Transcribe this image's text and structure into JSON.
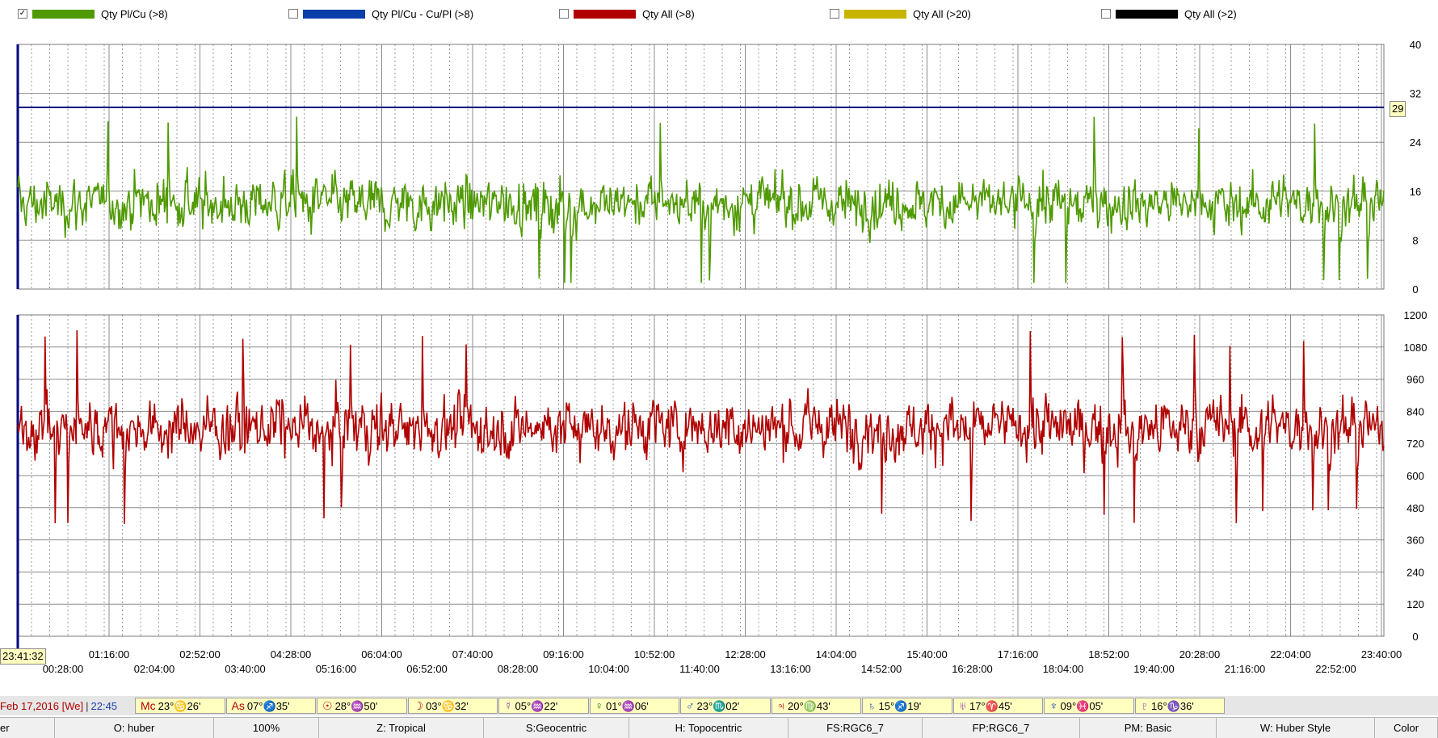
{
  "legend": [
    {
      "label": "Qty Pl/Cu (>8)",
      "color": "#4f9a00",
      "checked": true
    },
    {
      "label": "Qty Pl/Cu - Cu/Pl (>8)",
      "color": "#0a3eaa",
      "checked": false
    },
    {
      "label": "Qty All (>8)",
      "color": "#b00000",
      "checked": false
    },
    {
      "label": "Qty All (>20)",
      "color": "#c8b400",
      "checked": false
    },
    {
      "label": "Qty All (>2)",
      "color": "#000000",
      "checked": false
    }
  ],
  "chart_data": [
    {
      "type": "line",
      "series": [
        {
          "name": "Qty Pl/Cu (>8)",
          "color": "#4f9a00",
          "min": 1,
          "max": 29,
          "mean": 14
        }
      ],
      "threshold_line": {
        "value": 29.7,
        "label": "29",
        "color": "#000080"
      },
      "yticks": [
        0,
        8,
        16,
        24,
        32,
        40
      ],
      "ylim": [
        0,
        40
      ],
      "grid": true
    },
    {
      "type": "line",
      "series": [
        {
          "name": "Qty All (>8)",
          "color": "#b00000",
          "min": 420,
          "max": 1150,
          "mean": 780
        }
      ],
      "yticks": [
        0,
        120,
        240,
        360,
        480,
        600,
        720,
        840,
        960,
        1080,
        1200
      ],
      "ylim": [
        0,
        1200
      ],
      "grid": true
    }
  ],
  "time_axis": {
    "upper_labels": [
      "01:16:00",
      "02:52:00",
      "04:28:00",
      "06:04:00",
      "07:40:00",
      "09:16:00",
      "10:52:00",
      "12:28:00",
      "14:04:00",
      "15:40:00",
      "17:16:00",
      "18:52:00",
      "20:28:00",
      "22:04:00",
      "23:40:00"
    ],
    "middle_labels": [
      "02:04:00",
      "03:40:00",
      "05:16:00",
      "06:52:00",
      "08:28:00",
      "10:04:00",
      "11:40:00",
      "13:16:00",
      "14:52:00",
      "16:28:00",
      "18:04:00",
      "19:40:00",
      "21:16:00",
      "22:52:00"
    ],
    "lower_labels": [
      "00:28:00"
    ],
    "cursor_time": "23:41:32"
  },
  "planet_bar": {
    "date": "Feb 17,2016 [We]",
    "time": "22:45",
    "cells": [
      {
        "glyph": "Mc",
        "text": "23°♋26'",
        "color": "#b30000"
      },
      {
        "glyph": "As",
        "text": "07°♐35'",
        "color": "#b30000"
      },
      {
        "glyph": "☉",
        "text": "28°♒50'",
        "color": "#b30000"
      },
      {
        "glyph": "☽",
        "text": "03°♋32'",
        "color": "#b30000"
      },
      {
        "glyph": "☿",
        "text": "05°♒22'",
        "color": "#8a3ab0"
      },
      {
        "glyph": "♀",
        "text": "01°♒06'",
        "color": "#1a7a1a"
      },
      {
        "glyph": "♂",
        "text": "23°♏02'",
        "color": "#1a3fb0"
      },
      {
        "glyph": "♃",
        "text": "20°♍43'",
        "color": "#b30000"
      },
      {
        "glyph": "♄",
        "text": "15°♐19'",
        "color": "#1a3fb0"
      },
      {
        "glyph": "♅",
        "text": "17°♈45'",
        "color": "#8a3ab0"
      },
      {
        "glyph": "♆",
        "text": "09°♓05'",
        "color": "#1a3fb0"
      },
      {
        "glyph": "♇",
        "text": "16°♑36'",
        "color": "#8a3ab0"
      }
    ]
  },
  "status_bar": [
    "er",
    "O: huber",
    "100%",
    "Z: Tropical",
    "S:Geocentric",
    "H: Topocentric",
    "FS:RGC6_7",
    "FP:RGC6_7",
    "PM: Basic",
    "W: Huber Style",
    "Color"
  ]
}
